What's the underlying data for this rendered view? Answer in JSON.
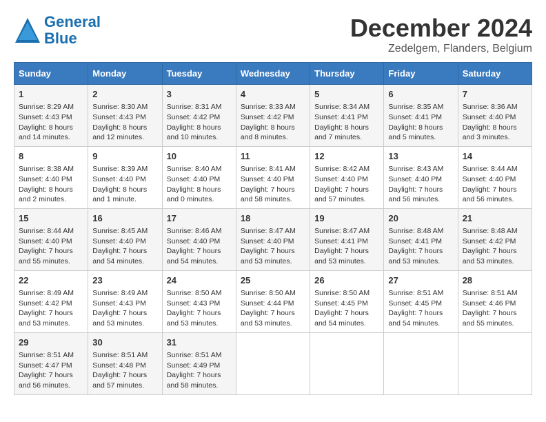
{
  "logo": {
    "line1": "General",
    "line2": "Blue"
  },
  "header": {
    "month": "December 2024",
    "location": "Zedelgem, Flanders, Belgium"
  },
  "days_of_week": [
    "Sunday",
    "Monday",
    "Tuesday",
    "Wednesday",
    "Thursday",
    "Friday",
    "Saturday"
  ],
  "weeks": [
    [
      {
        "day": "1",
        "info": "Sunrise: 8:29 AM\nSunset: 4:43 PM\nDaylight: 8 hours\nand 14 minutes."
      },
      {
        "day": "2",
        "info": "Sunrise: 8:30 AM\nSunset: 4:43 PM\nDaylight: 8 hours\nand 12 minutes."
      },
      {
        "day": "3",
        "info": "Sunrise: 8:31 AM\nSunset: 4:42 PM\nDaylight: 8 hours\nand 10 minutes."
      },
      {
        "day": "4",
        "info": "Sunrise: 8:33 AM\nSunset: 4:42 PM\nDaylight: 8 hours\nand 8 minutes."
      },
      {
        "day": "5",
        "info": "Sunrise: 8:34 AM\nSunset: 4:41 PM\nDaylight: 8 hours\nand 7 minutes."
      },
      {
        "day": "6",
        "info": "Sunrise: 8:35 AM\nSunset: 4:41 PM\nDaylight: 8 hours\nand 5 minutes."
      },
      {
        "day": "7",
        "info": "Sunrise: 8:36 AM\nSunset: 4:40 PM\nDaylight: 8 hours\nand 3 minutes."
      }
    ],
    [
      {
        "day": "8",
        "info": "Sunrise: 8:38 AM\nSunset: 4:40 PM\nDaylight: 8 hours\nand 2 minutes."
      },
      {
        "day": "9",
        "info": "Sunrise: 8:39 AM\nSunset: 4:40 PM\nDaylight: 8 hours\nand 1 minute."
      },
      {
        "day": "10",
        "info": "Sunrise: 8:40 AM\nSunset: 4:40 PM\nDaylight: 8 hours\nand 0 minutes."
      },
      {
        "day": "11",
        "info": "Sunrise: 8:41 AM\nSunset: 4:40 PM\nDaylight: 7 hours\nand 58 minutes."
      },
      {
        "day": "12",
        "info": "Sunrise: 8:42 AM\nSunset: 4:40 PM\nDaylight: 7 hours\nand 57 minutes."
      },
      {
        "day": "13",
        "info": "Sunrise: 8:43 AM\nSunset: 4:40 PM\nDaylight: 7 hours\nand 56 minutes."
      },
      {
        "day": "14",
        "info": "Sunrise: 8:44 AM\nSunset: 4:40 PM\nDaylight: 7 hours\nand 56 minutes."
      }
    ],
    [
      {
        "day": "15",
        "info": "Sunrise: 8:44 AM\nSunset: 4:40 PM\nDaylight: 7 hours\nand 55 minutes."
      },
      {
        "day": "16",
        "info": "Sunrise: 8:45 AM\nSunset: 4:40 PM\nDaylight: 7 hours\nand 54 minutes."
      },
      {
        "day": "17",
        "info": "Sunrise: 8:46 AM\nSunset: 4:40 PM\nDaylight: 7 hours\nand 54 minutes."
      },
      {
        "day": "18",
        "info": "Sunrise: 8:47 AM\nSunset: 4:40 PM\nDaylight: 7 hours\nand 53 minutes."
      },
      {
        "day": "19",
        "info": "Sunrise: 8:47 AM\nSunset: 4:41 PM\nDaylight: 7 hours\nand 53 minutes."
      },
      {
        "day": "20",
        "info": "Sunrise: 8:48 AM\nSunset: 4:41 PM\nDaylight: 7 hours\nand 53 minutes."
      },
      {
        "day": "21",
        "info": "Sunrise: 8:48 AM\nSunset: 4:42 PM\nDaylight: 7 hours\nand 53 minutes."
      }
    ],
    [
      {
        "day": "22",
        "info": "Sunrise: 8:49 AM\nSunset: 4:42 PM\nDaylight: 7 hours\nand 53 minutes."
      },
      {
        "day": "23",
        "info": "Sunrise: 8:49 AM\nSunset: 4:43 PM\nDaylight: 7 hours\nand 53 minutes."
      },
      {
        "day": "24",
        "info": "Sunrise: 8:50 AM\nSunset: 4:43 PM\nDaylight: 7 hours\nand 53 minutes."
      },
      {
        "day": "25",
        "info": "Sunrise: 8:50 AM\nSunset: 4:44 PM\nDaylight: 7 hours\nand 53 minutes."
      },
      {
        "day": "26",
        "info": "Sunrise: 8:50 AM\nSunset: 4:45 PM\nDaylight: 7 hours\nand 54 minutes."
      },
      {
        "day": "27",
        "info": "Sunrise: 8:51 AM\nSunset: 4:45 PM\nDaylight: 7 hours\nand 54 minutes."
      },
      {
        "day": "28",
        "info": "Sunrise: 8:51 AM\nSunset: 4:46 PM\nDaylight: 7 hours\nand 55 minutes."
      }
    ],
    [
      {
        "day": "29",
        "info": "Sunrise: 8:51 AM\nSunset: 4:47 PM\nDaylight: 7 hours\nand 56 minutes."
      },
      {
        "day": "30",
        "info": "Sunrise: 8:51 AM\nSunset: 4:48 PM\nDaylight: 7 hours\nand 57 minutes."
      },
      {
        "day": "31",
        "info": "Sunrise: 8:51 AM\nSunset: 4:49 PM\nDaylight: 7 hours\nand 58 minutes."
      },
      {
        "day": "",
        "info": ""
      },
      {
        "day": "",
        "info": ""
      },
      {
        "day": "",
        "info": ""
      },
      {
        "day": "",
        "info": ""
      }
    ]
  ]
}
